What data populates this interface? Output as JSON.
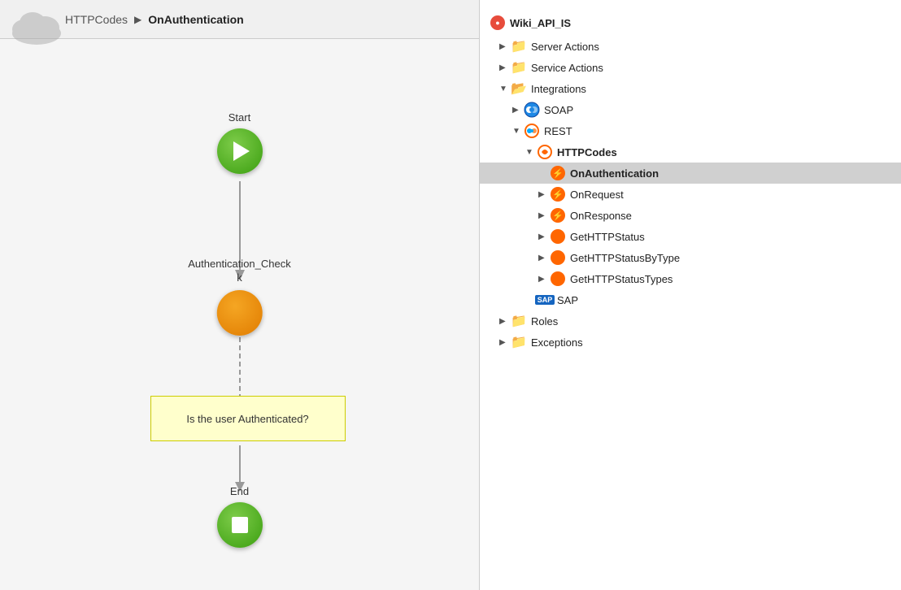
{
  "left_panel": {
    "breadcrumb": {
      "module": "HTTPCodes",
      "separator": "▶",
      "action": "OnAuthentication"
    },
    "flow": {
      "start_label": "Start",
      "action_label": "Authentication_Check",
      "comment_text": "Is the user Authenticated?",
      "end_label": "End"
    }
  },
  "right_panel": {
    "root_label": "Wiki_API_IS",
    "tree": [
      {
        "id": "server-actions",
        "label": "Server Actions",
        "indent": 1,
        "type": "folder",
        "collapsed": true
      },
      {
        "id": "service-actions",
        "label": "Service Actions",
        "indent": 1,
        "type": "folder",
        "collapsed": true
      },
      {
        "id": "integrations",
        "label": "Integrations",
        "indent": 1,
        "type": "folder-open",
        "collapsed": false
      },
      {
        "id": "soap",
        "label": "SOAP",
        "indent": 2,
        "type": "soap",
        "collapsed": true
      },
      {
        "id": "rest",
        "label": "REST",
        "indent": 2,
        "type": "rest",
        "collapsed": false
      },
      {
        "id": "httpcodes",
        "label": "HTTPCodes",
        "indent": 3,
        "type": "rest-sub",
        "collapsed": false
      },
      {
        "id": "on-authentication",
        "label": "OnAuthentication",
        "indent": 4,
        "type": "bolt",
        "selected": true
      },
      {
        "id": "on-request",
        "label": "OnRequest",
        "indent": 4,
        "type": "bolt",
        "collapsed": true
      },
      {
        "id": "on-response",
        "label": "OnResponse",
        "indent": 4,
        "type": "bolt",
        "collapsed": true
      },
      {
        "id": "get-http-status",
        "label": "GetHTTPStatus",
        "indent": 4,
        "type": "circle-orange",
        "collapsed": true
      },
      {
        "id": "get-http-status-by-type",
        "label": "GetHTTPStatusByType",
        "indent": 4,
        "type": "circle-orange",
        "collapsed": true
      },
      {
        "id": "get-http-status-types",
        "label": "GetHTTPStatusTypes",
        "indent": 4,
        "type": "circle-orange",
        "collapsed": true
      },
      {
        "id": "sap",
        "label": "SAP",
        "indent": 3,
        "type": "sap"
      },
      {
        "id": "roles",
        "label": "Roles",
        "indent": 1,
        "type": "folder",
        "collapsed": true
      },
      {
        "id": "exceptions",
        "label": "Exceptions",
        "indent": 1,
        "type": "folder",
        "collapsed": true
      }
    ]
  }
}
